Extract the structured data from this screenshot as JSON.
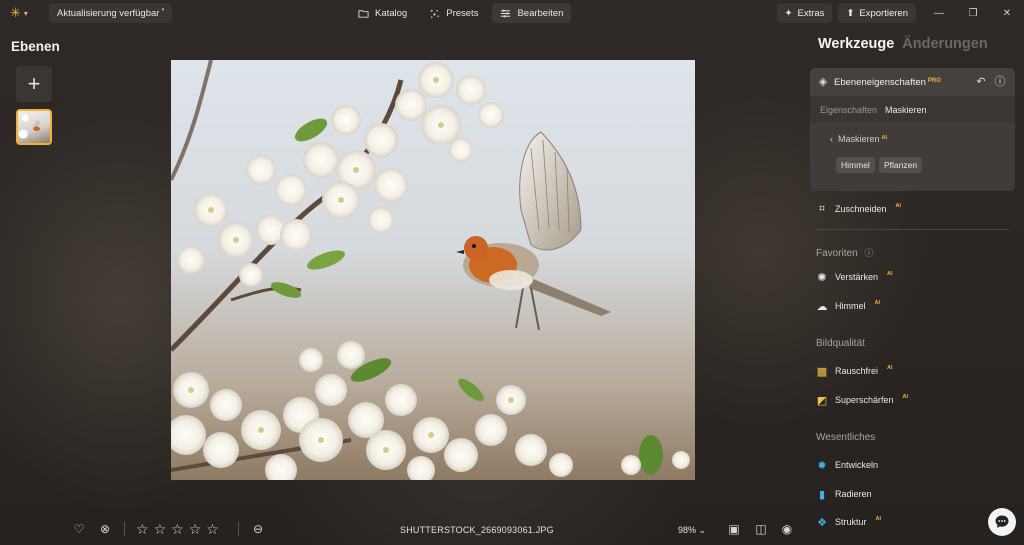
{
  "app": {
    "update_label": "Aktualisierung verfügbar",
    "update_dot": "•"
  },
  "nav": {
    "tabs": [
      {
        "label": "Katalog",
        "icon": "folder-icon",
        "active": false
      },
      {
        "label": "Presets",
        "icon": "sparkle-icon",
        "active": false
      },
      {
        "label": "Bearbeiten",
        "icon": "sliders-icon",
        "active": true
      }
    ]
  },
  "topright": {
    "extras_label": "Extras",
    "export_label": "Exportieren"
  },
  "left_panel": {
    "title": "Ebenen",
    "add_glyph": "+"
  },
  "bottom": {
    "filename": "SHUTTERSTOCK_2669093061.JPG",
    "zoom": "98% ⌄",
    "rating_stars": [
      "☆",
      "☆",
      "☆",
      "☆",
      "☆"
    ]
  },
  "right_panel": {
    "tabs": [
      {
        "label": "Werkzeuge",
        "active": true
      },
      {
        "label": "Änderungen",
        "active": false
      }
    ],
    "layer_props": {
      "title": "Ebeneneigenschaften",
      "pro_badge": "PRO",
      "subtabs": [
        {
          "label": "Eigenschaften",
          "active": false
        },
        {
          "label": "Maskieren",
          "active": true
        }
      ],
      "mask_back_label": "Maskieren",
      "ai_badge": "AI",
      "chips": [
        "Himmel",
        "Pflanzen"
      ]
    },
    "crop_label": "Zuschneiden",
    "sections": {
      "favorites": "Favoriten",
      "quality": "Bildqualität",
      "essentials": "Wesentliches"
    },
    "tools": {
      "enhance": "Verstärken",
      "sky": "Himmel",
      "denoise": "Rauschfrei",
      "supersharp": "Superschärfen",
      "develop": "Entwickeln",
      "erase": "Radieren",
      "structure": "Struktur"
    }
  },
  "colors": {
    "accent": "#f2b03b",
    "panel": "#3a3633"
  }
}
